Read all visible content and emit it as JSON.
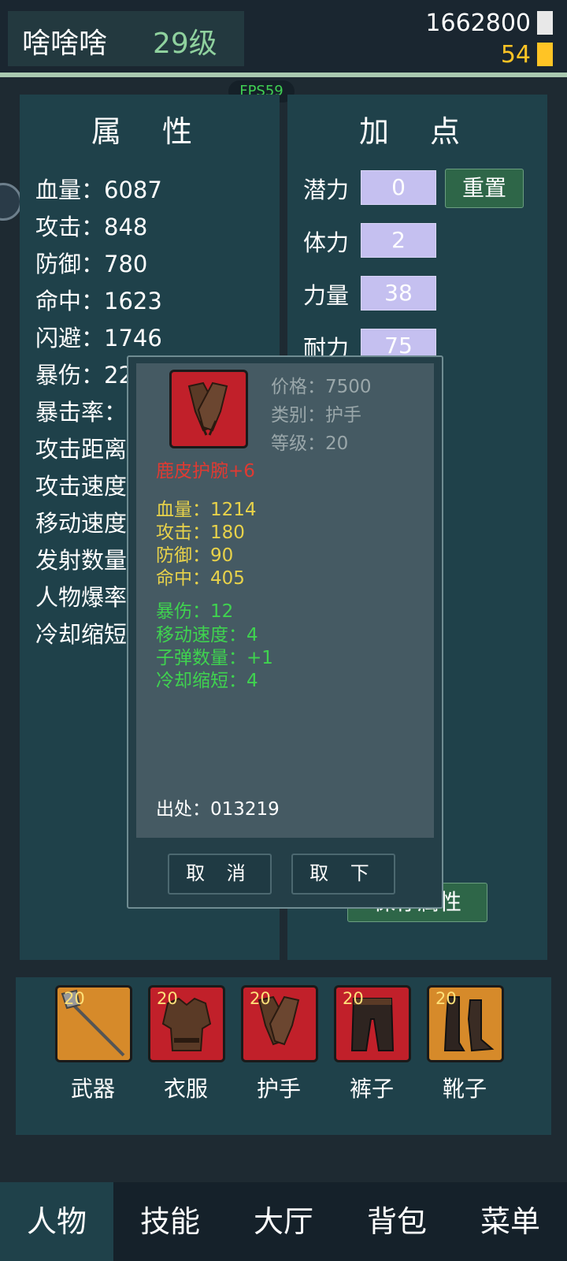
{
  "header": {
    "player_name": "啥啥啥",
    "player_level": "29级",
    "gold": "1662800",
    "gems": "54",
    "fps": "FPS59"
  },
  "attributes_panel": {
    "title": "属 性",
    "rows": [
      "血量：6087",
      "攻击：848",
      "防御：780",
      "命中：1623",
      "闪避：1746",
      "暴伤：22",
      "暴击率：",
      "攻击距离",
      "攻击速度",
      "移动速度",
      "发射数量",
      "人物爆率",
      "冷却缩短"
    ]
  },
  "points_panel": {
    "title": "加 点",
    "potential_label": "潜力",
    "potential_value": "0",
    "reset_label": "重置",
    "stamina_label": "体力",
    "stamina_value": "2",
    "strength_label": "力量",
    "strength_value": "38",
    "endurance_label": "耐力",
    "endurance_value": "75",
    "save_label": "保存属性"
  },
  "item_popup": {
    "price": "价格：7500",
    "category": "类别：护手",
    "level": "等级：20",
    "name": "鹿皮护腕+6",
    "base_stats": [
      "血量：1214",
      "攻击：180",
      "防御：90",
      "命中：405"
    ],
    "bonus_stats": [
      "暴伤：12",
      "移动速度：4",
      "子弹数量：+1",
      "冷却缩短：4"
    ],
    "origin": "出处：013219",
    "cancel_label": "取 消",
    "unequip_label": "取 下"
  },
  "equipment": [
    {
      "level": "20",
      "label": "武器",
      "icon": "polearm-icon",
      "rarity_color": "#d68a2a"
    },
    {
      "level": "20",
      "label": "衣服",
      "icon": "armor-icon",
      "rarity_color": "#c1202a"
    },
    {
      "level": "20",
      "label": "护手",
      "icon": "gauntlet-icon",
      "rarity_color": "#c1202a"
    },
    {
      "level": "20",
      "label": "裤子",
      "icon": "pants-icon",
      "rarity_color": "#c1202a"
    },
    {
      "level": "20",
      "label": "靴子",
      "icon": "boots-icon",
      "rarity_color": "#d68a2a"
    }
  ],
  "nav": [
    "人物",
    "技能",
    "大厅",
    "背包",
    "菜单"
  ],
  "nav_active": "人物"
}
